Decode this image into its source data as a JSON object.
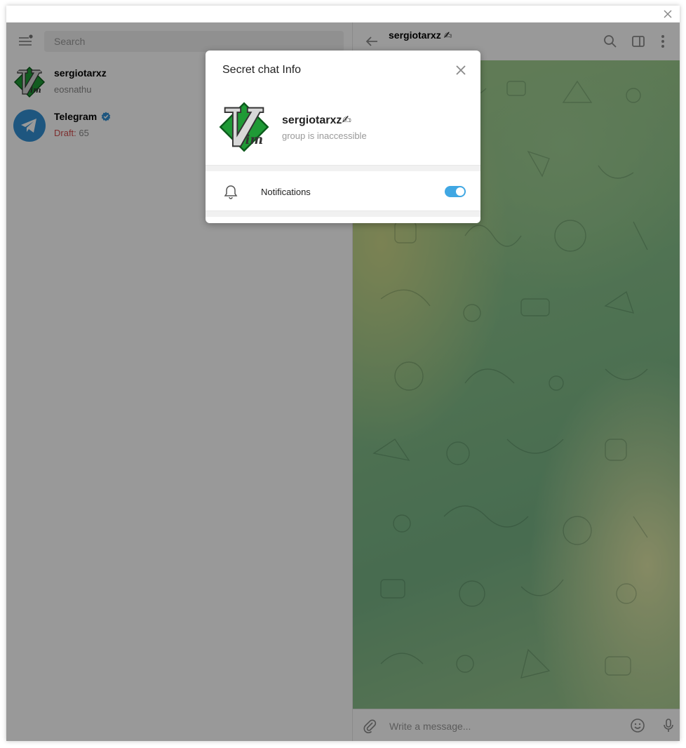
{
  "sidebar": {
    "search_placeholder": "Search",
    "chats": [
      {
        "name": "sergiotarxz",
        "preview": "eosnathu",
        "avatar_icon": "vim-logo-icon"
      },
      {
        "name": "Telegram",
        "draft_label": "Draft:",
        "draft_text": " 65",
        "avatar_icon": "telegram-plane-icon",
        "verified": true
      }
    ]
  },
  "chat": {
    "peer_name": "sergiotarxz",
    "peer_emoji": "✍",
    "composer_placeholder": "Write a message..."
  },
  "modal": {
    "title": "Secret chat Info",
    "name": "sergiotarxz",
    "name_emoji": "✍",
    "status": "group is inaccessible",
    "notifications_label": "Notifications",
    "notifications_enabled": true
  },
  "colors": {
    "accent": "#40a7e3",
    "telegram_blue": "#3390d4",
    "draft_red": "#d14e4e",
    "vim_green": "#1f9a36"
  }
}
